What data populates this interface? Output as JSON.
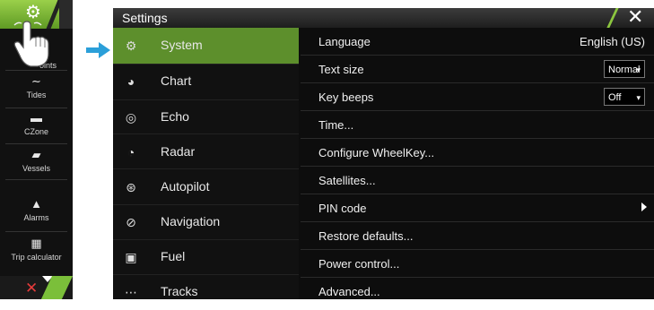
{
  "sidebar": {
    "items": [
      {
        "label": "Waypoints",
        "visible_label": "oints",
        "icon": "waypoint-icon"
      },
      {
        "label": "Tides",
        "icon": "tides-icon"
      },
      {
        "label": "CZone",
        "icon": "czone-icon"
      },
      {
        "label": "Vessels",
        "icon": "vessel-icon"
      },
      {
        "label": "Alarms",
        "icon": "alarm-bell-icon"
      },
      {
        "label": "Trip calculator",
        "icon": "trip-calculator-icon"
      }
    ],
    "close_icon": "close-icon"
  },
  "dialog": {
    "title": "Settings",
    "close_icon": "close-icon",
    "categories": [
      {
        "label": "System",
        "icon": "gear-icon",
        "active": true
      },
      {
        "label": "Chart",
        "icon": "globe-icon"
      },
      {
        "label": "Echo",
        "icon": "echo-icon"
      },
      {
        "label": "Radar",
        "icon": "radar-icon"
      },
      {
        "label": "Autopilot",
        "icon": "helm-icon"
      },
      {
        "label": "Navigation",
        "icon": "compass-icon"
      },
      {
        "label": "Fuel",
        "icon": "fuel-pump-icon"
      },
      {
        "label": "Tracks",
        "icon": "tracks-icon"
      }
    ],
    "options": [
      {
        "label": "Language",
        "value": "English (US)"
      },
      {
        "label": "Text size",
        "dropdown": "Normal"
      },
      {
        "label": "Key beeps",
        "dropdown": "Off"
      },
      {
        "label": "Time..."
      },
      {
        "label": "Configure WheelKey..."
      },
      {
        "label": "Satellites..."
      },
      {
        "label": "PIN code",
        "submenu": true
      },
      {
        "label": "Restore defaults..."
      },
      {
        "label": "Power control..."
      },
      {
        "label": "Advanced..."
      }
    ]
  },
  "colors": {
    "accent_green": "#5d8f2c",
    "highlight_green": "#8cc63f",
    "pointer_blue": "#2b9fd9",
    "close_red": "#e43b3b"
  }
}
